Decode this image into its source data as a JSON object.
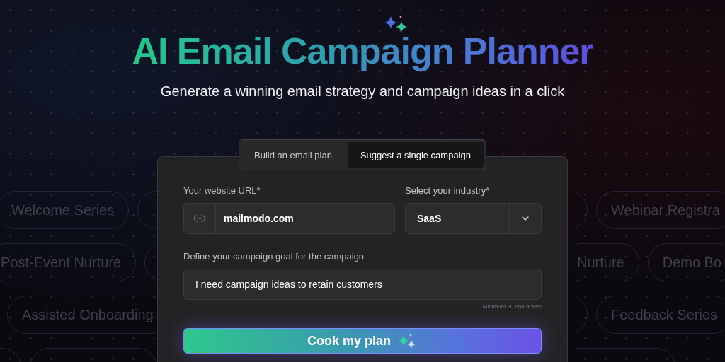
{
  "header": {
    "title": "AI Email Campaign Planner",
    "subtitle": "Generate a winning email strategy and campaign ideas in a click"
  },
  "background_tags": {
    "left_rows": [
      [
        {
          "kind": "tag",
          "label": "Welcome Series"
        },
        {
          "kind": "blank"
        }
      ],
      [
        {
          "kind": "tag",
          "label": "Post-Event Nurture"
        },
        {
          "kind": "blank"
        }
      ],
      [
        {
          "kind": "tag",
          "label": "Assisted Onboarding"
        }
      ],
      [
        {
          "kind": "blank"
        },
        {
          "kind": "blank"
        }
      ]
    ],
    "right_rows": [
      [
        {
          "kind": "blank"
        },
        {
          "kind": "tag",
          "label": "Webinar Registra"
        }
      ],
      [
        {
          "kind": "tag",
          "label": "Nurture"
        },
        {
          "kind": "tag",
          "label": "Demo Bo"
        }
      ],
      [
        {
          "kind": "blank"
        },
        {
          "kind": "tag",
          "label": "Feedback Series"
        }
      ],
      [
        {
          "kind": "blank"
        }
      ]
    ]
  },
  "tabs": [
    {
      "label": "Build an email plan",
      "selected": false
    },
    {
      "label": "Suggest a single campaign",
      "selected": true
    }
  ],
  "form": {
    "url": {
      "label": "Your website URL*",
      "value": "mailmodo.com"
    },
    "industry": {
      "label": "Select your industry*",
      "value": "SaaS"
    },
    "goal": {
      "label": "Define your campaign goal for the campaign",
      "value": "I need campaign ideas to retain customers",
      "hint": "Minimum 30 characters"
    },
    "submit": "Cook my plan"
  }
}
